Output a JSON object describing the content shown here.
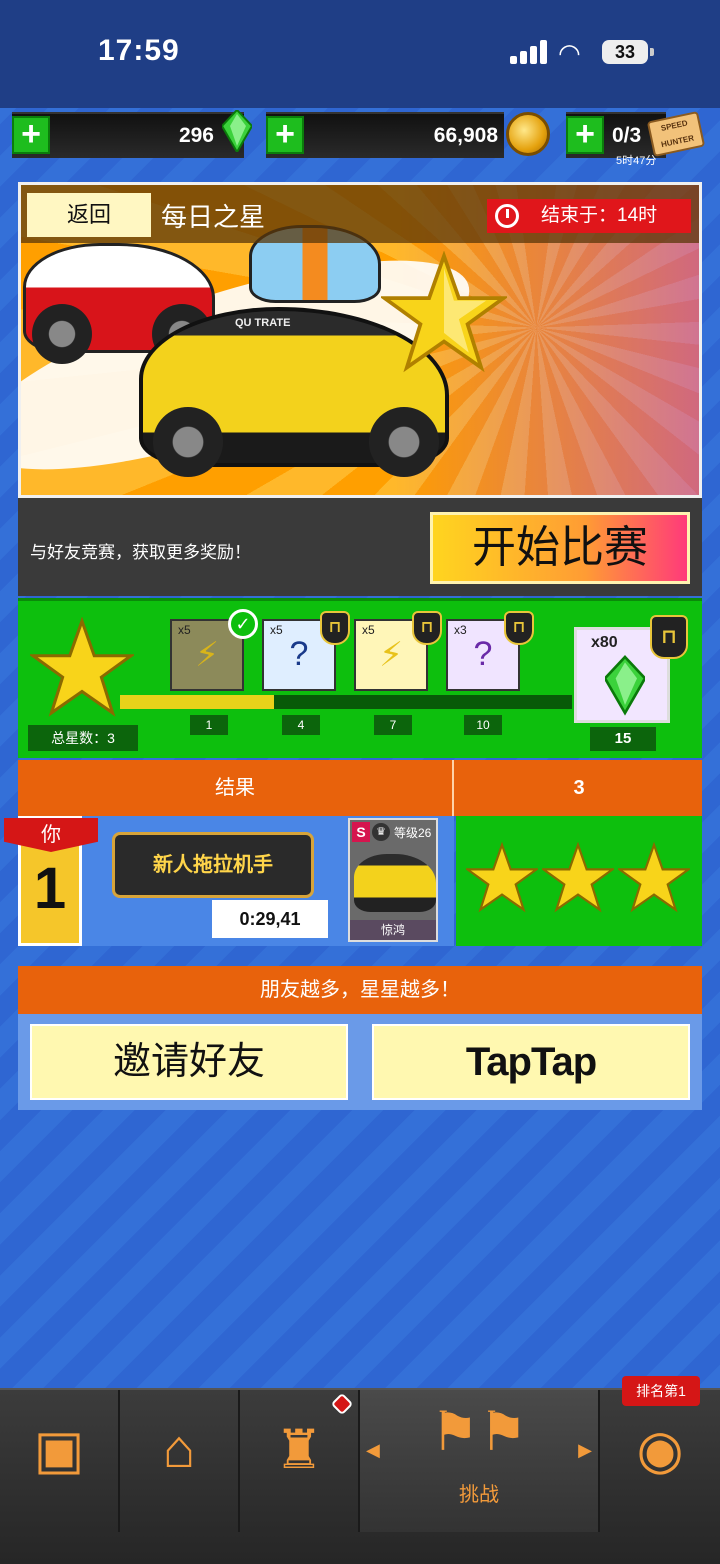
{
  "status_bar": {
    "time": "17:59",
    "battery": "33"
  },
  "currencies": {
    "gems": "296",
    "coins": "66,908",
    "tickets": "0/3",
    "ticket_timer": "5时47分",
    "ticket_label": "SPEED HUNTER"
  },
  "event": {
    "back_label": "返回",
    "title": "每日之星",
    "ends_label": "结束于：14时",
    "car_plate_text": "QU TRATE"
  },
  "cta": {
    "text": "与好友竞赛，获取更多奖励！",
    "start_label": "开始比赛"
  },
  "rewards": {
    "total_stars_label": "总星数：3",
    "progress": 0.34,
    "items": [
      {
        "mult": "x5",
        "icon": "lightning-icon",
        "threshold": "1",
        "claimed": true,
        "locked": false
      },
      {
        "mult": "x5",
        "icon": "mystery-token-icon",
        "threshold": "4",
        "claimed": false,
        "locked": true
      },
      {
        "mult": "x5",
        "icon": "lightning-icon",
        "threshold": "7",
        "claimed": false,
        "locked": true
      },
      {
        "mult": "x3",
        "icon": "mystery-gem-icon",
        "threshold": "10",
        "claimed": false,
        "locked": true
      }
    ],
    "final": {
      "mult": "x80",
      "icon": "green-gem-icon",
      "threshold": "15",
      "locked": true
    }
  },
  "results": {
    "header_left": "结果",
    "header_right": "3",
    "you_label": "你",
    "rank": "1",
    "player_name": "新人拖拉机手",
    "time": "0:29,41",
    "car": {
      "class": "S",
      "level": "等级26",
      "name": "惊鸿"
    },
    "stars": 3
  },
  "friends": {
    "header": "朋友越多，星星越多！",
    "invite_label": "邀请好友",
    "taptap_label": "TapTap"
  },
  "nav": {
    "challenge_label": "挑战",
    "rank_badge": "排名第1"
  },
  "colors": {
    "accent_orange": "#e8620c",
    "reward_green": "#0dbf0d",
    "alert_red": "#e0161b",
    "star_yellow": "#f5d21a"
  }
}
